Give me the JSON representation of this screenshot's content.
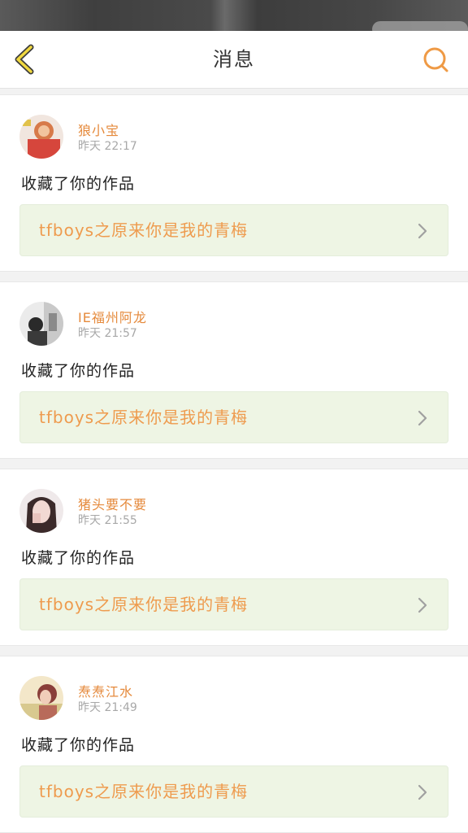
{
  "header": {
    "title": "消息",
    "back_icon": "chevron-left-icon",
    "search_icon": "search-icon"
  },
  "colors": {
    "accent": "#e58a3c",
    "link_bg": "#eef5e4",
    "link_text": "#ee9b4e"
  },
  "messages": [
    {
      "username": "狼小宝",
      "time": "昨天 22:17",
      "action": "收藏了你的作品",
      "work_title": "tfboys之原来你是我的青梅"
    },
    {
      "username": "IE福州阿龙",
      "time": "昨天 21:57",
      "action": "收藏了你的作品",
      "work_title": "tfboys之原来你是我的青梅"
    },
    {
      "username": "猪头要不要",
      "time": "昨天 21:55",
      "action": "收藏了你的作品",
      "work_title": "tfboys之原来你是我的青梅"
    },
    {
      "username": "焘焘江水",
      "time": "昨天 21:49",
      "action": "收藏了你的作品",
      "work_title": "tfboys之原来你是我的青梅"
    }
  ]
}
